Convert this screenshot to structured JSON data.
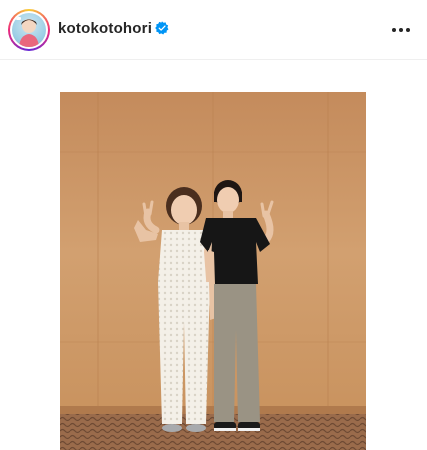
{
  "post": {
    "username": "kotokotohori",
    "verified": true
  },
  "icons": {
    "verified": "verified-badge-icon",
    "more": "more-options-icon"
  },
  "colors": {
    "verified_blue": "#0095f6",
    "text": "#262626"
  }
}
